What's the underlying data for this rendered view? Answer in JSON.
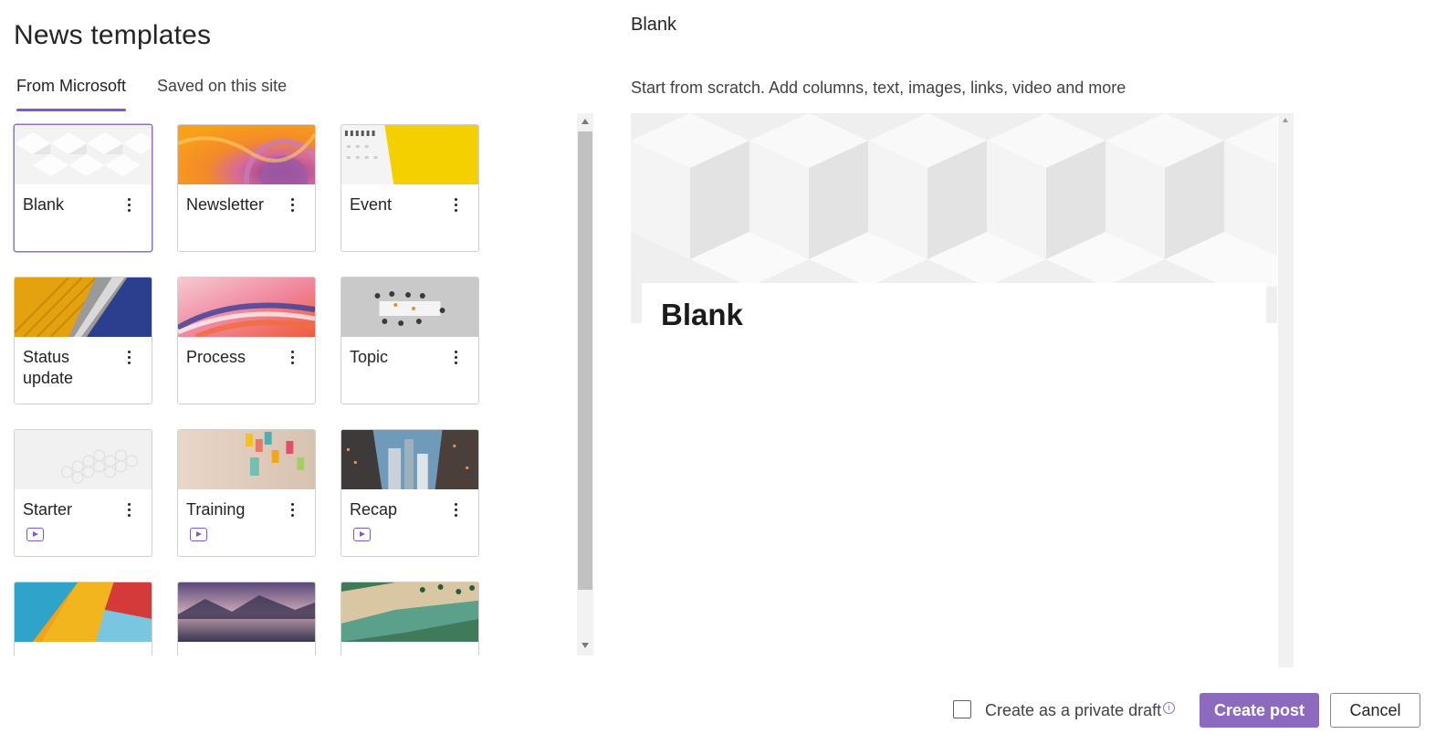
{
  "page_title": "News templates",
  "tabs": [
    {
      "label": "From Microsoft",
      "active": true
    },
    {
      "label": "Saved on this site",
      "active": false
    }
  ],
  "templates": [
    {
      "label": "Blank",
      "selected": true,
      "video": false
    },
    {
      "label": "Newsletter",
      "video": false
    },
    {
      "label": "Event",
      "video": false
    },
    {
      "label": "Status update",
      "video": false
    },
    {
      "label": "Process",
      "video": false
    },
    {
      "label": "Topic",
      "video": false
    },
    {
      "label": "Starter",
      "video": true
    },
    {
      "label": "Training",
      "video": true
    },
    {
      "label": "Recap",
      "video": true
    },
    {
      "label": "",
      "video": false
    },
    {
      "label": "",
      "video": false
    },
    {
      "label": "",
      "video": false
    }
  ],
  "preview": {
    "title": "Blank",
    "description": "Start from scratch. Add columns, text, images, links, video and more",
    "heading": "Blank"
  },
  "footer": {
    "private_draft_label": "Create as a private draft",
    "private_draft_checked": false,
    "create_button": "Create post",
    "cancel_button": "Cancel"
  },
  "colors": {
    "accent": "#7c5ac9",
    "primary_button": "#8c6bbf"
  }
}
